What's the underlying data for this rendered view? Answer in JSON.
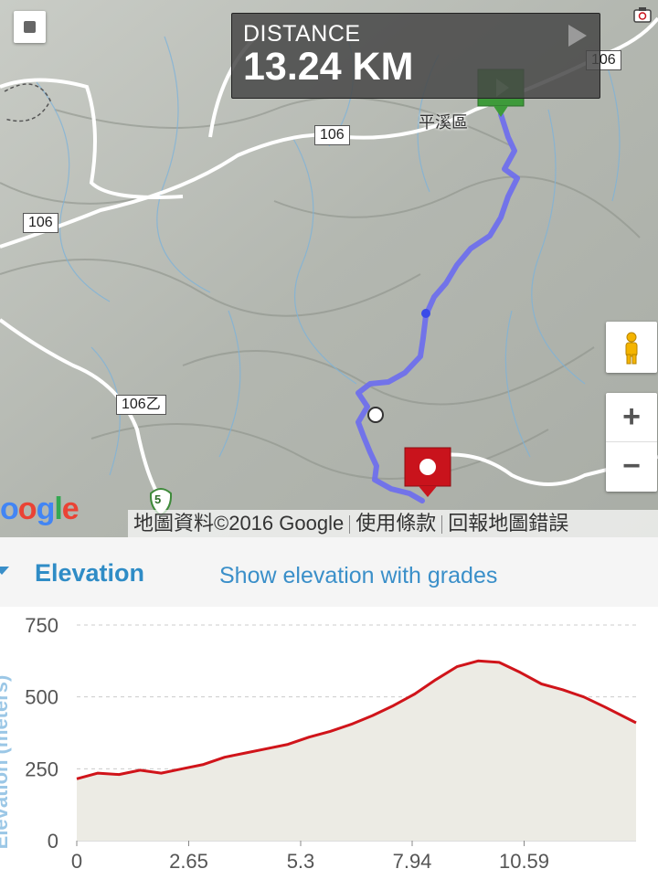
{
  "map": {
    "distance_label": "DISTANCE",
    "distance_value": "13.24 KM",
    "road_labels": [
      "106",
      "106",
      "106",
      "106乙"
    ],
    "place_label": "平溪區",
    "route_color": "#6b6cf0",
    "google_logo": "oogle",
    "footer": {
      "copyright": "地圖資料©2016 Google",
      "terms": "使用條款",
      "report": "回報地圖錯誤"
    },
    "zoom_in": "+",
    "zoom_out": "−",
    "route_number_badge": "5",
    "icons": [
      "layers-square-icon",
      "camera-icon",
      "play-icon",
      "start-flag-icon",
      "end-marker-icon",
      "pegman-icon"
    ]
  },
  "elevation": {
    "title": "Elevation",
    "grades_link": "Show elevation with grades",
    "accent_color": "#2f8cc6"
  },
  "chart_data": {
    "type": "area",
    "ylabel": "Elevation (meters)",
    "xlabel": "",
    "ylim": [
      0,
      750
    ],
    "xlim": [
      0,
      13.24
    ],
    "x_ticks": [
      "0",
      "2.65",
      "5.3",
      "7.94",
      "10.59"
    ],
    "y_ticks": [
      "750",
      "500",
      "250",
      "0"
    ],
    "line_color": "#d0141a",
    "fill_color": "#ecebe4",
    "grid": true,
    "series": [
      {
        "x": [
          0,
          0.5,
          1.0,
          1.5,
          2.0,
          2.5,
          3.0,
          3.5,
          4.0,
          4.5,
          5.0,
          5.5,
          6.0,
          6.5,
          7.0,
          7.5,
          8.0,
          8.5,
          9.0,
          9.5,
          10.0,
          10.5,
          11.0,
          11.5,
          12.0,
          12.5,
          13.24
        ],
        "values": [
          215,
          235,
          230,
          245,
          235,
          250,
          265,
          290,
          305,
          320,
          335,
          360,
          380,
          405,
          435,
          470,
          510,
          560,
          605,
          625,
          620,
          585,
          545,
          525,
          500,
          465,
          410
        ]
      }
    ]
  }
}
